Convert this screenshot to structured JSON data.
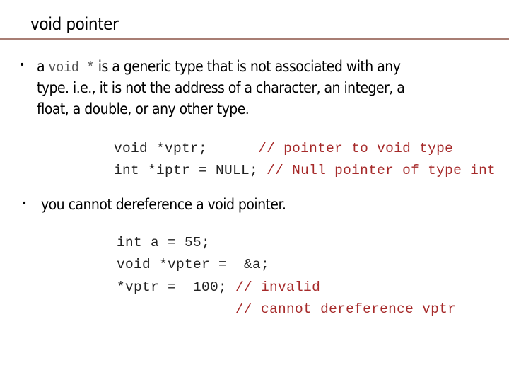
{
  "slide": {
    "title": "void pointer"
  },
  "colors": {
    "comment": "#a62a2a",
    "code": "#222222",
    "inline_code": "#555555",
    "divider_light": "#d9cfb4",
    "divider_dark": "#a87e74"
  },
  "bullets": [
    {
      "bullet_glyph": "•",
      "prefix": "a ",
      "inline_code": "void *",
      "line1_rest": " is a generic type that is not associated with any",
      "line2": "type.  i.e., it is not the address of a character, an integer, a",
      "line3": "float, a double, or any other type.",
      "code": [
        {
          "code": "void *vptr;      ",
          "comment": "// pointer to void type"
        },
        {
          "code": "int *iptr = NULL; ",
          "comment": "// Null pointer of type int"
        }
      ]
    },
    {
      "bullet_glyph": "•",
      "text": "you cannot dereference a void pointer.",
      "code": [
        {
          "code": "int a = 55;",
          "comment": ""
        },
        {
          "code": "void *vpter =  &a;",
          "comment": ""
        },
        {
          "code": "*vptr =  100; ",
          "comment": "// invalid"
        },
        {
          "code": "              ",
          "comment": "// cannot dereference vptr"
        }
      ]
    }
  ]
}
